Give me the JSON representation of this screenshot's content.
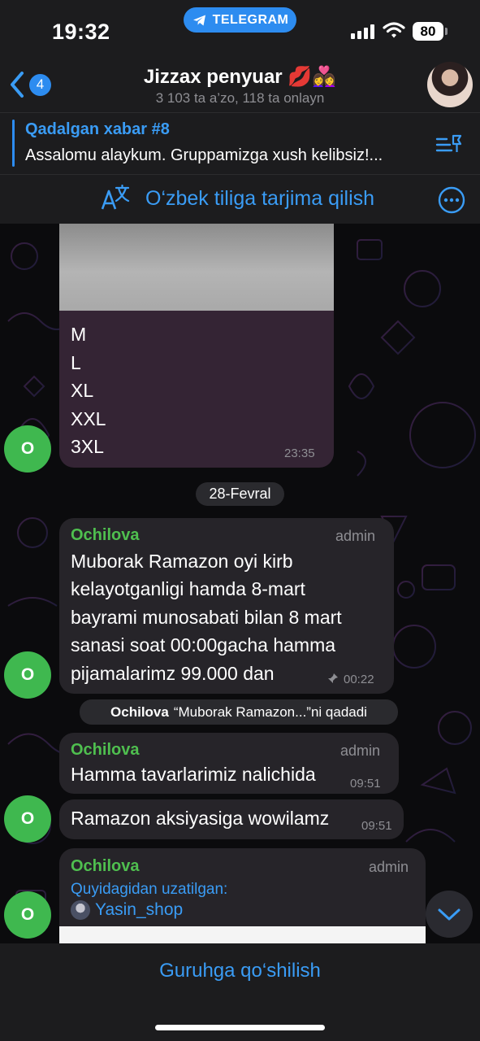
{
  "status": {
    "time": "19:32",
    "app_pill": "TELEGRAM",
    "battery": "80"
  },
  "header": {
    "back_badge": "4",
    "title": "Jizzax penyuar 💋👩‍❤️‍👩",
    "subtitle": "3 103 ta a’zo, 118 ta onlayn"
  },
  "pinned": {
    "title": "Qadalgan xabar #8",
    "text": "Assalomu alaykum. Gruppamizga xush kelibsiz!..."
  },
  "translate": {
    "label": "O‘zbek tiliga tarjima qilish"
  },
  "messages": {
    "m1": {
      "sizes": [
        "M",
        "L",
        "XL",
        "XXL",
        "3XL"
      ],
      "time": "23:35",
      "avatar": "O"
    },
    "date_chip": "28-Fevral",
    "m2": {
      "sender": "Ochilova",
      "role": "admin",
      "lines": [
        "Muborak Ramazon oyi kirb",
        "kelayotganligi hamda 8-mart",
        "bayrami munosabati bilan 8 mart",
        "sanasi soat 00:00gacha hamma",
        "pijamalarimz 99.000 dan"
      ],
      "time": "00:22",
      "avatar": "O"
    },
    "pin_notice": {
      "who": "Ochilova",
      "text": "“Muborak Ramazon...”ni qadadi"
    },
    "m3": {
      "sender": "Ochilova",
      "role": "admin",
      "text": "Hamma tavarlarimiz nalichida",
      "time": "09:51"
    },
    "m4": {
      "text": "Ramazon aksiyasiga wowilamz",
      "time": "09:51",
      "avatar": "O"
    },
    "m5": {
      "sender": "Ochilova",
      "role": "admin",
      "forward_label": "Quyidagidan uzatilgan:",
      "forward_from": "Yasin_shop",
      "avatar": "O"
    }
  },
  "footer": {
    "join_label": "Guruhga qo‘shilish"
  },
  "icons": [
    "telegram-icon",
    "signal-icon",
    "wifi-icon",
    "back-chevron-icon",
    "pinned-list-icon",
    "translate-icon",
    "more-icon",
    "pin-icon",
    "chevron-down-icon"
  ],
  "colors": {
    "accent": "#2d8cf0",
    "link": "#3a9cf5",
    "sender": "#4fbf4f",
    "avatar": "#3fb84f"
  }
}
